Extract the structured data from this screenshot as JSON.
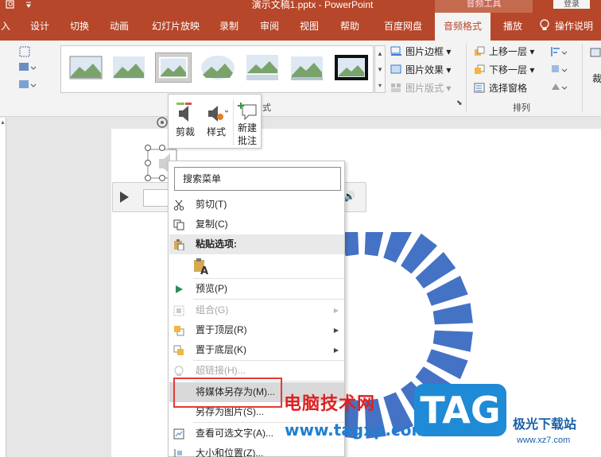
{
  "window": {
    "title": "演示文稿1.pptx  -  PowerPoint",
    "context_group": "音频工具",
    "login_label": "登录",
    "accent_color": "#b7472a"
  },
  "tabs": [
    {
      "label": "入"
    },
    {
      "label": "设计"
    },
    {
      "label": "切换"
    },
    {
      "label": "动画"
    },
    {
      "label": "幻灯片放映"
    },
    {
      "label": "录制"
    },
    {
      "label": "审阅"
    },
    {
      "label": "视图"
    },
    {
      "label": "帮助"
    },
    {
      "label": "百度网盘"
    },
    {
      "label": "音频格式",
      "active": true
    },
    {
      "label": "播放"
    },
    {
      "label": "操作说明"
    }
  ],
  "ribbon": {
    "picture_border": "图片边框",
    "picture_effects": "图片效果",
    "picture_layout": "图片版式",
    "styles_group": "式",
    "bring_forward": "上移一层",
    "send_backward": "下移一层",
    "selection_pane": "选择窗格",
    "arrange_group": "排列",
    "crop_partial": "裁"
  },
  "mini_toolbar": {
    "crop": "剪裁",
    "style": "样式",
    "new_comment_line1": "新建",
    "new_comment_line2": "批注"
  },
  "context_menu": {
    "search_placeholder": "搜索菜单",
    "cut": "剪切(T)",
    "copy": "复制(C)",
    "paste_options": "粘贴选项:",
    "preview": "预览(P)",
    "group": "组合(G)",
    "bring_to_front": "置于顶层(R)",
    "send_to_back": "置于底层(K)",
    "hyperlink": "超链接(H)...",
    "save_media_as": "将媒体另存为(M)...",
    "save_as_picture": "另存为图片(S)...",
    "edit_alt_text": "查看可选文字(A)...",
    "size_position": "大小和位置(Z)..."
  },
  "watermark": {
    "cn_text": "电脑技术网",
    "url": "www.tagxp.com",
    "tag": "TAG",
    "site_name": "极光下载站",
    "site_url": "www.xz7.com"
  }
}
